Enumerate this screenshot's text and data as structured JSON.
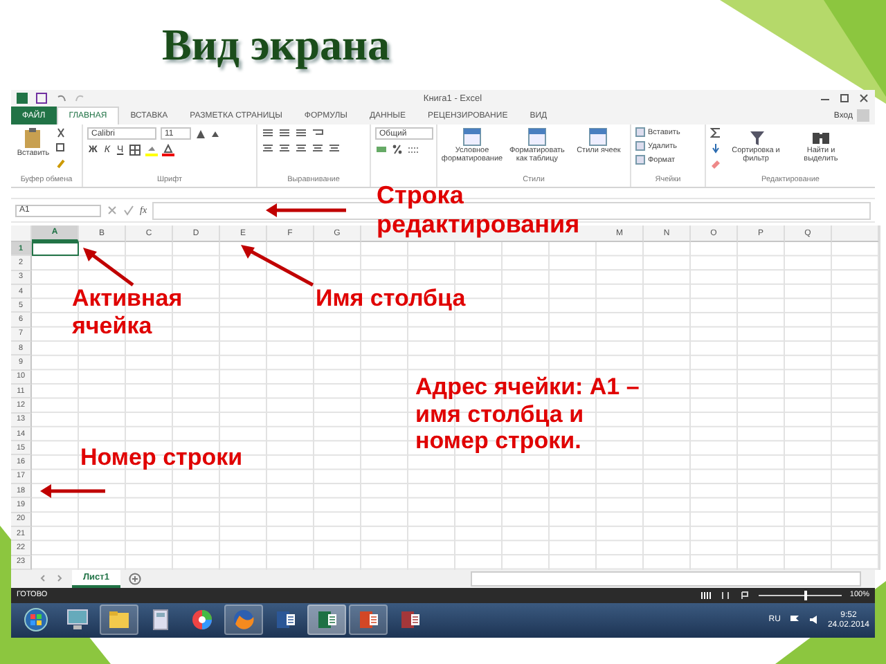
{
  "slide": {
    "title": "Вид экрана"
  },
  "excel": {
    "window_title": "Книга1 - Excel",
    "sign_in": "Вход",
    "tabs": [
      {
        "label": "ФАЙЛ",
        "kind": "file",
        "selected": false
      },
      {
        "label": "ГЛАВНАЯ",
        "kind": "tab",
        "selected": true
      },
      {
        "label": "ВСТАВКА",
        "kind": "tab",
        "selected": false
      },
      {
        "label": "РАЗМЕТКА СТРАНИЦЫ",
        "kind": "tab",
        "selected": false
      },
      {
        "label": "ФОРМУЛЫ",
        "kind": "tab",
        "selected": false
      },
      {
        "label": "ДАННЫЕ",
        "kind": "tab",
        "selected": false
      },
      {
        "label": "РЕЦЕНЗИРОВАНИЕ",
        "kind": "tab",
        "selected": false
      },
      {
        "label": "ВИД",
        "kind": "tab",
        "selected": false
      }
    ],
    "ribbon": {
      "paste": "Вставить",
      "font": "Calibri",
      "size": "11",
      "bold": "Ж",
      "italic": "К",
      "underline": "Ч",
      "number_format": "Общий",
      "style_buttons": [
        "Условное форматирование",
        "Форматировать как таблицу",
        "Стили ячеек"
      ],
      "cell_buttons": [
        "Вставить",
        "Удалить",
        "Формат"
      ],
      "edit_buttons": [
        "Сортировка и фильтр",
        "Найти и выделить"
      ],
      "groups": [
        "Буфер обмена",
        "Шрифт",
        "Выравнивание",
        "Стили",
        "Ячейки",
        "Редактирование"
      ]
    },
    "name_box": "A1",
    "fx": "fx",
    "columns": [
      {
        "label": "A",
        "selected": true
      },
      {
        "label": "B",
        "selected": false
      },
      {
        "label": "C",
        "selected": false
      },
      {
        "label": "D",
        "selected": false
      },
      {
        "label": "E",
        "selected": false
      },
      {
        "label": "F",
        "selected": false
      },
      {
        "label": "G",
        "selected": false
      },
      {
        "kind": "covered"
      },
      {
        "kind": "covered"
      },
      {
        "kind": "covered"
      },
      {
        "kind": "covered"
      },
      {
        "kind": "covered"
      },
      {
        "label": "M",
        "selected": false
      },
      {
        "label": "N",
        "selected": false
      },
      {
        "label": "O",
        "selected": false
      },
      {
        "label": "P",
        "selected": false
      },
      {
        "label": "Q",
        "selected": false
      }
    ],
    "rows": [
      {
        "label": "1",
        "selected": true
      },
      {
        "label": "2",
        "selected": false
      },
      {
        "label": "3",
        "selected": false
      },
      {
        "label": "4",
        "selected": false
      },
      {
        "label": "5",
        "selected": false
      },
      {
        "label": "6",
        "selected": false
      },
      {
        "label": "7",
        "selected": false
      },
      {
        "label": "8",
        "selected": false
      },
      {
        "label": "9",
        "selected": false
      },
      {
        "label": "10",
        "selected": false
      },
      {
        "label": "11",
        "selected": false
      },
      {
        "label": "12",
        "selected": false
      },
      {
        "label": "13",
        "selected": false
      },
      {
        "label": "14",
        "selected": false
      },
      {
        "label": "15",
        "selected": false
      },
      {
        "label": "16",
        "selected": false
      },
      {
        "label": "17",
        "selected": false
      },
      {
        "label": "18",
        "selected": false
      },
      {
        "label": "19",
        "selected": false
      },
      {
        "label": "20",
        "selected": false
      },
      {
        "label": "21",
        "selected": false
      },
      {
        "label": "22",
        "selected": false
      },
      {
        "label": "23",
        "selected": false
      }
    ],
    "sheets": [
      {
        "label": "Лист1",
        "selected": true
      }
    ],
    "status": "ГОТОВО",
    "zoom": {
      "level": 0.55,
      "reading": "100%"
    }
  },
  "taskbar": {
    "apps": [
      {
        "kind": "start",
        "open": false,
        "selected": false
      },
      {
        "kind": "computer",
        "open": false,
        "selected": false
      },
      {
        "kind": "folder",
        "open": true,
        "selected": false
      },
      {
        "kind": "calculator",
        "open": false,
        "selected": false
      },
      {
        "kind": "photos",
        "open": false,
        "selected": false
      },
      {
        "kind": "browser",
        "open": true,
        "selected": false
      },
      {
        "kind": "word",
        "open": false,
        "selected": false
      },
      {
        "kind": "excel",
        "open": true,
        "selected": true
      },
      {
        "kind": "powerpoint",
        "open": true,
        "selected": false
      },
      {
        "kind": "access",
        "open": false,
        "selected": false
      }
    ],
    "language": "RU",
    "time": "9:52",
    "date": "24.02.2014"
  },
  "annotations": [
    {
      "text": "Строка редактирования"
    },
    {
      "text": "Активная ячейка"
    },
    {
      "text": "Имя столбца"
    },
    {
      "text": "Адрес ячейки: А1 – имя столбца и номер строки."
    },
    {
      "text": "Номер строки"
    }
  ]
}
